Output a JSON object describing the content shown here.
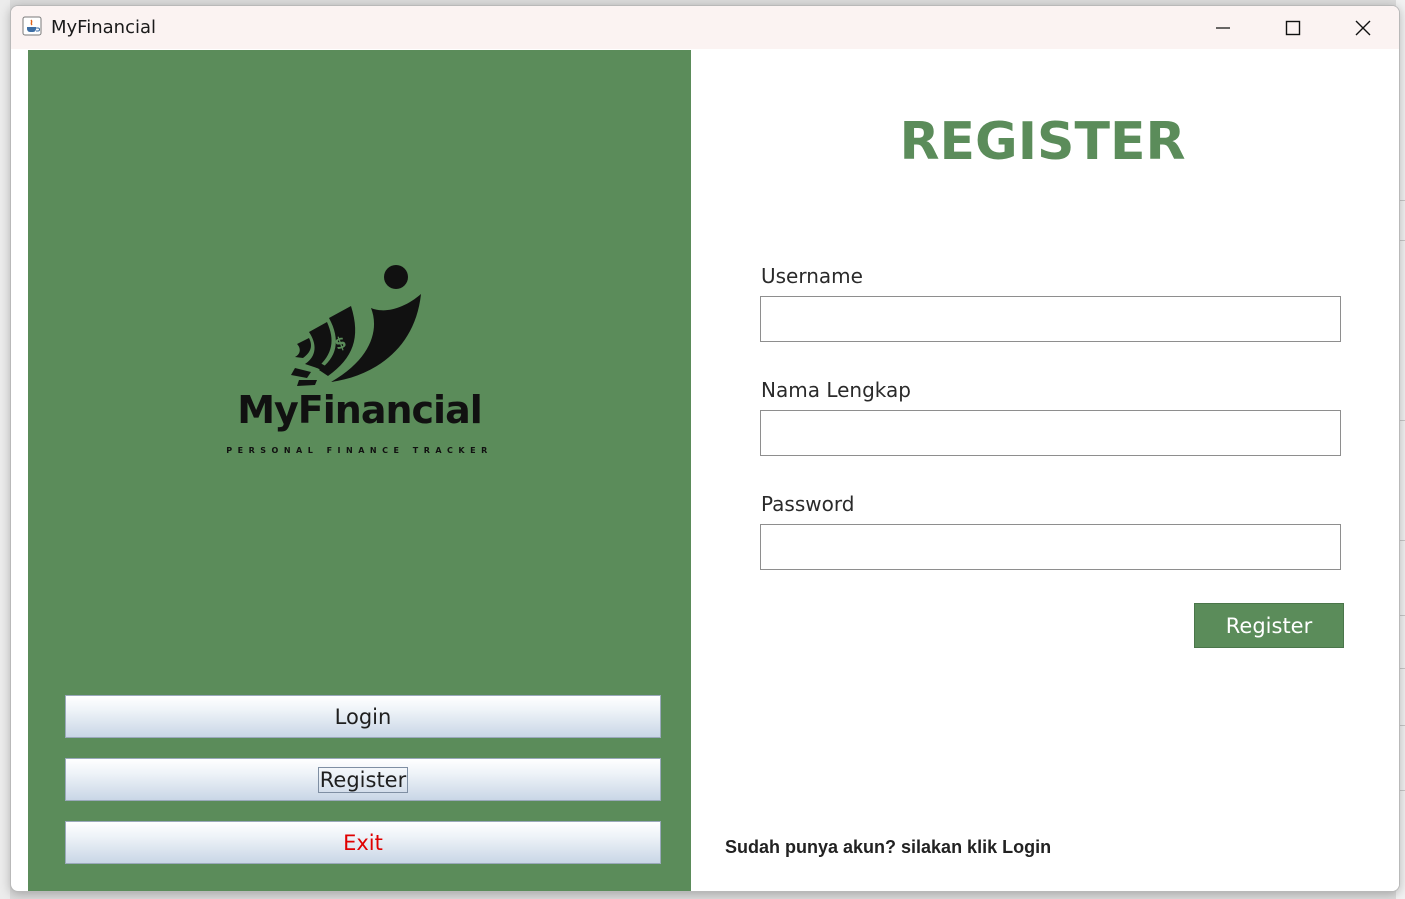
{
  "window": {
    "title": "MyFinancial",
    "icon": "java-cup-icon"
  },
  "window_controls": {
    "minimize": "minimize-icon",
    "maximize": "maximize-icon",
    "close": "close-icon"
  },
  "sidebar": {
    "brand_name": "MyFinancial",
    "tagline": "PERSONAL FINANCE TRACKER",
    "buttons": [
      {
        "label": "Login"
      },
      {
        "label": "Register"
      },
      {
        "label": "Exit"
      }
    ]
  },
  "form": {
    "heading": "REGISTER",
    "fields": [
      {
        "label": "Username",
        "value": ""
      },
      {
        "label": "Nama Lengkap",
        "value": ""
      },
      {
        "label": "Password",
        "value": ""
      }
    ],
    "submit_label": "Register",
    "footer": "Sudah punya akun? silakan klik Login"
  },
  "colors": {
    "accent": "#5b8c5a",
    "exit_text": "#e00000",
    "titlebar": "#fbf3f2"
  }
}
